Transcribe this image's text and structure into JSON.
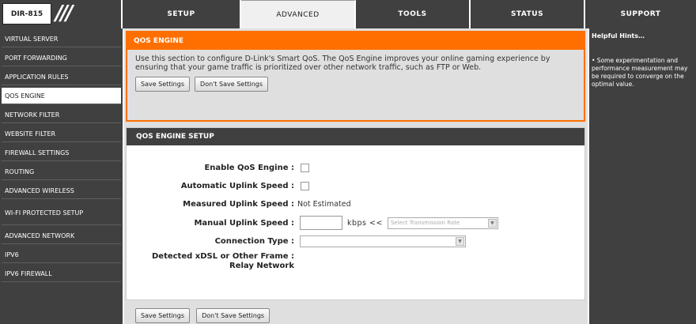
{
  "header": {
    "model": "DIR-815",
    "slashes": "///"
  },
  "nav": {
    "tabs": [
      "SETUP",
      "ADVANCED",
      "TOOLS",
      "STATUS",
      "SUPPORT"
    ]
  },
  "sidebar": {
    "items": [
      {
        "label": "VIRTUAL SERVER"
      },
      {
        "label": "PORT FORWARDING"
      },
      {
        "label": "APPLICATION RULES"
      },
      {
        "label": "QOS ENGINE"
      },
      {
        "label": "NETWORK FILTER"
      },
      {
        "label": "WEBSITE FILTER"
      },
      {
        "label": "FIREWALL SETTINGS"
      },
      {
        "label": "ROUTING"
      },
      {
        "label": "ADVANCED WIRELESS"
      },
      {
        "label": "WI-FI PROTECTED SETUP"
      },
      {
        "label": "ADVANCED NETWORK"
      },
      {
        "label": "IPV6"
      },
      {
        "label": "IPV6 FIREWALL"
      }
    ]
  },
  "qos_panel": {
    "title": "QOS ENGINE",
    "description": "Use this section to configure D-Link's Smart QoS. The QoS Engine improves your online gaming experience by ensuring that your game traffic is prioritized over other network traffic, such as FTP or Web.",
    "save_label": "Save Settings",
    "dont_save_label": "Don't Save Settings"
  },
  "setup_panel": {
    "title": "QOS ENGINE SETUP",
    "enable_label": "Enable QoS Engine :",
    "auto_uplink_label": "Automatic Uplink Speed :",
    "measured_label": "Measured Uplink Speed :",
    "measured_value": "Not Estimated",
    "manual_label": "Manual Uplink Speed :",
    "manual_value": "",
    "kbps": "kbps  <<",
    "rate_placeholder": "Select Transmission Rate",
    "connection_label": "Connection Type :",
    "connection_value": "",
    "detected_label_1": "Detected xDSL or Other Frame :",
    "detected_label_2": "Relay Network"
  },
  "bottom": {
    "save_label": "Save Settings",
    "dont_save_label": "Don't Save Settings"
  },
  "hints": {
    "title": "Helpful Hints…",
    "text": "•  Some experimentation and performance measurement may be required to converge on the optimal value."
  },
  "colors": {
    "accent": "#ff6f00",
    "dark": "#404040"
  }
}
